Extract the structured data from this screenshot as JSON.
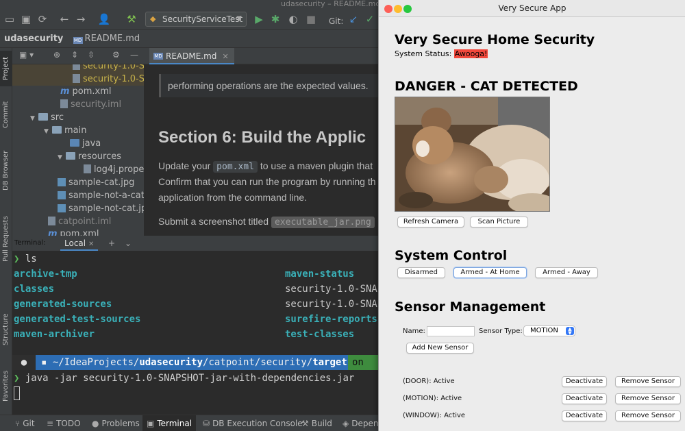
{
  "ide": {
    "window_title": "udasecurity – README.md [u",
    "run_config": "SecurityServiceTest",
    "git_label": "Git:",
    "breadcrumb": {
      "project": "udasecurity",
      "file": "README.md"
    },
    "left_tabs": [
      "Project",
      "Commit",
      "DB Browser",
      "Pull Requests",
      "Structure",
      "Favorites"
    ],
    "tree": [
      {
        "label": "security-1.0-S",
        "kind": "jar",
        "hl": true
      },
      {
        "label": "security-1.0-S",
        "kind": "jar",
        "hl": true
      },
      {
        "label": "pom.xml",
        "kind": "maven"
      },
      {
        "label": "security.iml",
        "kind": "iml"
      },
      {
        "label": "src",
        "kind": "folder"
      },
      {
        "label": "main",
        "kind": "folder"
      },
      {
        "label": "java",
        "kind": "srcfolder"
      },
      {
        "label": "resources",
        "kind": "resfolder"
      },
      {
        "label": "log4j.prope",
        "kind": "props"
      },
      {
        "label": "sample-cat.jpg",
        "kind": "image"
      },
      {
        "label": "sample-not-a-cat",
        "kind": "image"
      },
      {
        "label": "sample-not-cat.jp",
        "kind": "image"
      },
      {
        "label": "catpoint.iml",
        "kind": "iml"
      },
      {
        "label": "pom.xml",
        "kind": "maven"
      }
    ],
    "editor_tab": "README.md",
    "editor": {
      "note": "performing operations are the expected values.",
      "section_heading": "Section 6: Build the Applic",
      "line1_pre": "Update your",
      "line1_code": "pom.xml",
      "line1_post": "to use a maven plugin that",
      "line2": "Confirm that you can run the program by running th",
      "line3": "application from the command line.",
      "line4_pre": "Submit a screenshot titled",
      "line4_code": "executable_jar.png"
    },
    "terminal": {
      "header_label": "Terminal:",
      "tab": "Local",
      "prompt": "❯",
      "cmd1": "ls",
      "col1": [
        "archive-tmp",
        "classes",
        "generated-sources",
        "generated-test-sources",
        "maven-archiver"
      ],
      "col1_kind": [
        "dir",
        "dir",
        "dir",
        "dir",
        "dir"
      ],
      "col2": [
        "maven-status",
        "security-1.0-SNAP",
        "security-1.0-SNAF",
        "surefire-reports",
        "test-classes"
      ],
      "col2_kind": [
        "dir",
        "file",
        "file",
        "dir",
        "dir"
      ],
      "path_prefix": "~/IdeaProjects/",
      "path_bold1": "udasecurity",
      "path_mid": "/catpoint/security/",
      "path_bold2": "target",
      "git_seg": "on",
      "cmd2": "java -jar security-1.0-SNAPSHOT-jar-with-dependencies.jar"
    },
    "bottom_tabs": [
      "Git",
      "TODO",
      "Problems",
      "Terminal",
      "DB Execution Console",
      "Build",
      "Depend"
    ]
  },
  "app": {
    "window_title": "Very Secure App",
    "heading": "Very Secure Home Security",
    "status_label": "System Status:",
    "status_value": "Awooga!",
    "danger_heading": "DANGER - CAT DETECTED",
    "refresh_button": "Refresh Camera",
    "scan_button": "Scan Picture",
    "system_control_heading": "System Control",
    "disarmed_button": "Disarmed",
    "armed_home_button": "Armed - At Home",
    "armed_away_button": "Armed - Away",
    "sensor_mgmt_heading": "Sensor Management",
    "name_label": "Name:",
    "name_value": "",
    "sensor_type_label": "Sensor Type:",
    "sensor_type_value": "MOTION",
    "add_sensor_button": "Add New Sensor",
    "sensors": [
      {
        "label": "(DOOR): Active",
        "deactivate": "Deactivate",
        "remove": "Remove Sensor"
      },
      {
        "label": "(MOTION): Active",
        "deactivate": "Deactivate",
        "remove": "Remove Sensor"
      },
      {
        "label": "(WINDOW): Active",
        "deactivate": "Deactivate",
        "remove": "Remove Sensor"
      }
    ],
    "colors": {
      "alarm": "#f2483c",
      "close": "#fd5f57",
      "minimize": "#febc2e",
      "zoom": "#28c840"
    }
  }
}
